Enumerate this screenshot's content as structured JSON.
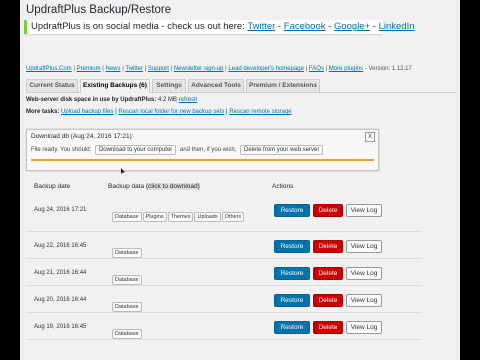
{
  "page": {
    "title": "UpdraftPlus Backup/Restore",
    "notice": {
      "text": "UpdraftPlus is on social media - check us out here: ",
      "links": [
        "Twitter",
        "Facebook",
        "Google+",
        "LinkedIn"
      ],
      "separator": " - "
    },
    "links": [
      "UpdraftPlus.Com",
      "Premium",
      "News",
      "Twitter",
      "Support",
      "Newsletter sign-up",
      "Lead developer's homepage",
      "FAQs",
      "More plugins"
    ],
    "version": "- Version: 1.12.17"
  },
  "tabs": [
    "Current Status",
    "Existing Backups (6)",
    "Settings",
    "Advanced Tools",
    "Premium / Extensions"
  ],
  "disk": {
    "label": "Web-server disk space in use by UpdraftPlus:",
    "value": "4.2 MB",
    "refresh": "refresh"
  },
  "more_tasks": {
    "label": "More tasks:",
    "links": [
      "Upload backup files",
      "Rescan local folder for new backup sets",
      "Rescan remote storage"
    ]
  },
  "download_box": {
    "title": "Download db (Aug 24, 2016 17:21):",
    "close": "X",
    "ready_prefix": "File ready. You should:",
    "btn_download": "Download to your computer",
    "mid": "and then, if you wish,",
    "btn_delete": "Delete from your web server",
    "progress": 1.0
  },
  "table": {
    "col_date": "Backup date",
    "col_data": "Backup data",
    "col_data_hint": "(click to download)",
    "col_actions": "Actions",
    "rows": [
      {
        "date": "Aug 24, 2016 17:21",
        "items": [
          "Database",
          "Plugins",
          "Themes",
          "Uploads",
          "Others"
        ]
      },
      {
        "date": "Aug 22, 2016 16:45",
        "items": [
          "Database"
        ]
      },
      {
        "date": "Aug 21, 2016 16:44",
        "items": [
          "Database"
        ]
      },
      {
        "date": "Aug 20, 2016 16:44",
        "items": [
          "Database"
        ]
      },
      {
        "date": "Aug 19, 2016 16:45",
        "items": [
          "Database"
        ]
      }
    ]
  },
  "actions": {
    "restore": "Restore",
    "delete": "Delete",
    "view_log": "View Log"
  },
  "colors": {
    "accent": "#0073aa",
    "delete": "#cc0000",
    "notice_border": "#7ad03a",
    "progress": "#e9a03b"
  }
}
